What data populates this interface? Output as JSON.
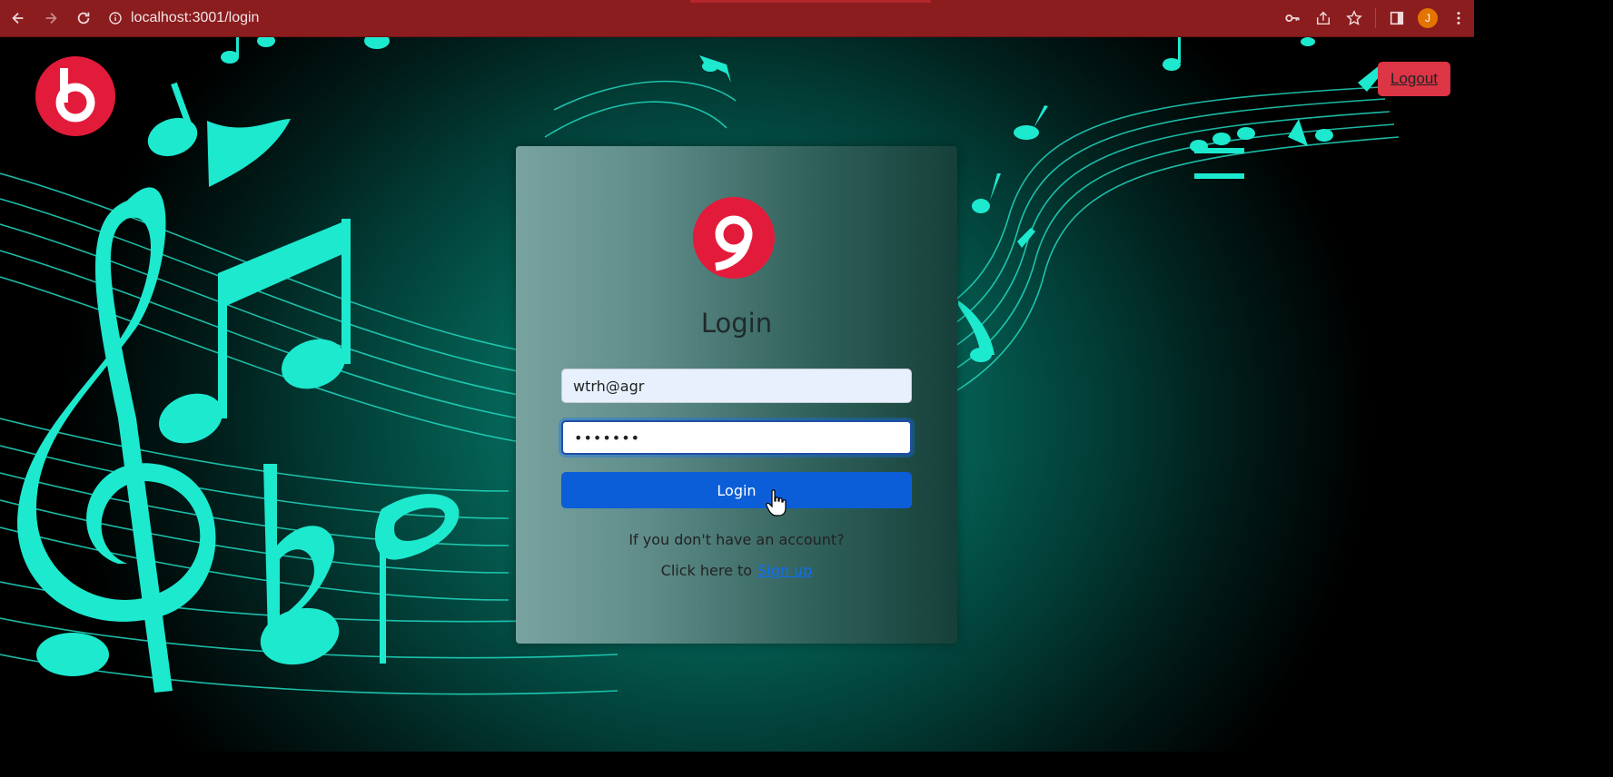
{
  "browser": {
    "url": "localhost:3001/login",
    "profile_initial": "J",
    "icons": [
      "back-icon",
      "forward-icon",
      "reload-icon",
      "info-icon",
      "key-icon",
      "share-icon",
      "star-icon",
      "side-panel-icon",
      "more-icon"
    ]
  },
  "header": {
    "logout_label": "Logout"
  },
  "login": {
    "title": "Login",
    "email_value": "wtrh@agr",
    "password_value": "•••••••",
    "button_label": "Login",
    "account_text": "If you don't have an account?",
    "signup_prefix": "Click here to",
    "signup_link": "Sign up"
  },
  "colors": {
    "chrome": "#8b1d1f",
    "brand_red": "#e31b3b",
    "notes": "#1de9cf",
    "button_blue": "#0b5ed7",
    "logout_red": "#dc3545"
  }
}
